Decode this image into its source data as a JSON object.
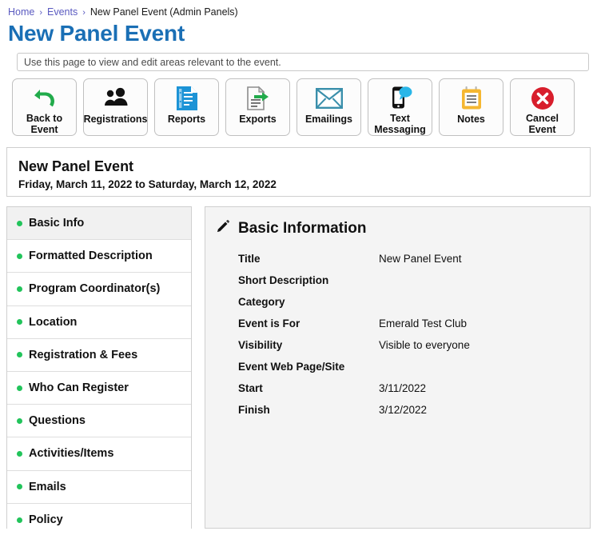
{
  "breadcrumb": {
    "items": [
      {
        "label": "Home",
        "link": true
      },
      {
        "label": "Events",
        "link": true
      },
      {
        "label": "New Panel Event (Admin Panels)",
        "link": false
      }
    ],
    "separator": "›"
  },
  "page": {
    "title": "New Panel Event",
    "title_color": "#1a6fb5",
    "help_text": "Use this page to view and edit areas relevant to the event."
  },
  "toolbar": {
    "buttons": [
      {
        "label": "Back to Event",
        "icon": "undo-arrow-icon",
        "color": "#22ab4b"
      },
      {
        "label": "Registrations",
        "icon": "two-people-icon",
        "color": "#111111"
      },
      {
        "label": "Reports",
        "icon": "blue-document-icon",
        "color": "#1c93d6"
      },
      {
        "label": "Exports",
        "icon": "document-export-arrow-icon",
        "color": "#22ab4b"
      },
      {
        "label": "Emailings",
        "icon": "envelope-icon",
        "color": "#3a8fab"
      },
      {
        "label": "Text Messaging",
        "icon": "phone-chat-bubble-icon",
        "color": "#29b6e8"
      },
      {
        "label": "Notes",
        "icon": "notepad-icon",
        "color": "#f5b731"
      },
      {
        "label": "Cancel Event",
        "icon": "red-x-circle-icon",
        "color": "#d81e2c"
      }
    ]
  },
  "event_header": {
    "name": "New Panel Event",
    "dates": "Friday, March 11, 2022 to Saturday, March 12, 2022"
  },
  "sidebar": {
    "items": [
      {
        "label": "Basic Info",
        "active": true
      },
      {
        "label": "Formatted Description",
        "active": false
      },
      {
        "label": "Program Coordinator(s)",
        "active": false
      },
      {
        "label": "Location",
        "active": false
      },
      {
        "label": "Registration & Fees",
        "active": false
      },
      {
        "label": "Who Can Register",
        "active": false
      },
      {
        "label": "Questions",
        "active": false
      },
      {
        "label": "Activities/Items",
        "active": false
      },
      {
        "label": "Emails",
        "active": false
      },
      {
        "label": "Policy",
        "active": false
      }
    ],
    "status_dot_color": "#22c45b"
  },
  "detail": {
    "title": "Basic Information",
    "edit_icon": "pencil-icon",
    "fields": [
      {
        "label": "Title",
        "value": "New Panel Event"
      },
      {
        "label": "Short Description",
        "value": ""
      },
      {
        "label": "Category",
        "value": ""
      },
      {
        "label": "Event is For",
        "value": "Emerald Test Club"
      },
      {
        "label": "Visibility",
        "value": "Visible to everyone"
      },
      {
        "label": "Event Web Page/Site",
        "value": ""
      },
      {
        "label": "Start",
        "value": "3/11/2022"
      },
      {
        "label": "Finish",
        "value": "3/12/2022"
      }
    ]
  }
}
